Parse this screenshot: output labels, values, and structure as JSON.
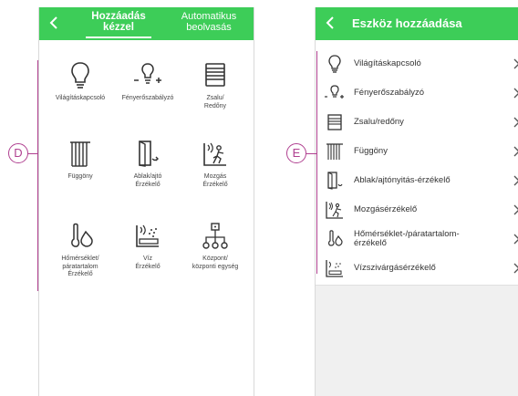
{
  "left_screen": {
    "header": {
      "tab_manual_line1": "Hozzáadás",
      "tab_manual_line2": "kézzel",
      "tab_auto_line1": "Automatikus",
      "tab_auto_line2": "beolvasás"
    },
    "callout": "D",
    "tiles": [
      {
        "label": "Világításkapcsoló",
        "icon": "bulb-icon"
      },
      {
        "label": "Fényerőszabályzó",
        "icon": "dimmer-icon"
      },
      {
        "label": "Zsalu/\nRedőny",
        "icon": "shutter-icon"
      },
      {
        "label": "Függöny",
        "icon": "curtain-icon"
      },
      {
        "label": "Ablak/ajtó\nÉrzékelő",
        "icon": "door-sensor-icon"
      },
      {
        "label": "Mozgás\nÉrzékelő",
        "icon": "motion-sensor-icon"
      },
      {
        "label": "Hőmérséklet/\npáratartalom\nÉrzékelő",
        "icon": "temp-humidity-icon"
      },
      {
        "label": "Víz\nÉrzékelő",
        "icon": "water-sensor-icon"
      },
      {
        "label": "Központ/\nközponti egység",
        "icon": "hub-icon"
      }
    ]
  },
  "right_screen": {
    "header": {
      "title": "Eszköz hozzáadása"
    },
    "callout": "E",
    "items": [
      {
        "label": "Világításkapcsoló",
        "icon": "bulb-icon"
      },
      {
        "label": "Fényerőszabályzó",
        "icon": "dimmer-icon"
      },
      {
        "label": "Zsalu/redőny",
        "icon": "shutter-icon"
      },
      {
        "label": "Függöny",
        "icon": "curtain-icon"
      },
      {
        "label": "Ablak/ajtónyitás-érzékelő",
        "icon": "door-sensor-icon"
      },
      {
        "label": "Mozgásérzékelő",
        "icon": "motion-sensor-icon"
      },
      {
        "label": "Hőmérséklet-/páratartalom-\nérzékelő",
        "icon": "temp-humidity-icon"
      },
      {
        "label": "Vízszivárgásérzékelő",
        "icon": "water-sensor-icon"
      }
    ]
  },
  "colors": {
    "brand_green": "#3dcd58",
    "callout": "#b04090"
  }
}
